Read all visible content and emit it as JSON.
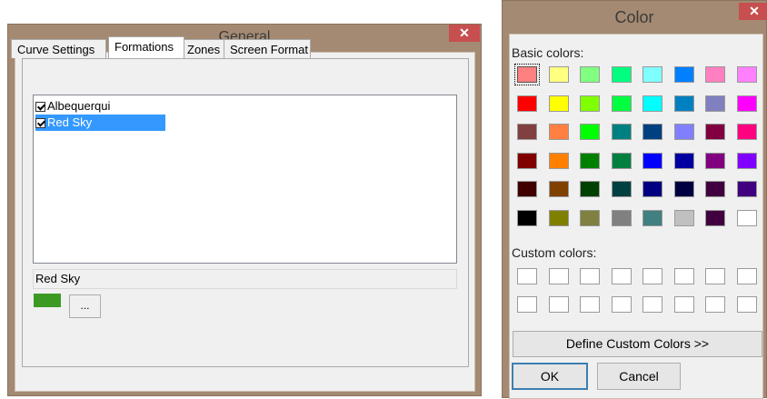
{
  "general": {
    "title": "General",
    "close_glyph": "✕",
    "tabs": [
      {
        "label": "Curve Settings"
      },
      {
        "label": "Formations"
      },
      {
        "label": "Zones"
      },
      {
        "label": "Screen Format"
      }
    ],
    "active_tab": "Formations",
    "formations": [
      {
        "label": "Albequerqui",
        "checked": true,
        "selected": false
      },
      {
        "label": "Red Sky",
        "checked": true,
        "selected": true
      }
    ],
    "selected_name": "Red Sky",
    "selected_color": "#3c9a24",
    "browse_label": "..."
  },
  "color_dialog": {
    "title": "Color",
    "close_glyph": "✕",
    "basic_label": "Basic colors:",
    "custom_label": "Custom colors:",
    "basic_colors": [
      [
        "#ff8080",
        "#ffff80",
        "#80ff80",
        "#00ff80",
        "#80ffff",
        "#0080ff",
        "#ff80c0",
        "#ff80ff"
      ],
      [
        "#ff0000",
        "#ffff00",
        "#80ff00",
        "#00ff40",
        "#00ffff",
        "#0080c0",
        "#8080c0",
        "#ff00ff"
      ],
      [
        "#804040",
        "#ff8040",
        "#00ff00",
        "#008080",
        "#004080",
        "#8080ff",
        "#800040",
        "#ff0080"
      ],
      [
        "#800000",
        "#ff8000",
        "#008000",
        "#008040",
        "#0000ff",
        "#0000a0",
        "#800080",
        "#8000ff"
      ],
      [
        "#400000",
        "#804000",
        "#004000",
        "#004040",
        "#000080",
        "#000040",
        "#400040",
        "#400080"
      ],
      [
        "#000000",
        "#808000",
        "#808040",
        "#808080",
        "#408080",
        "#c0c0c0",
        "#400040",
        "#ffffff"
      ]
    ],
    "selected_basic": "#ff8080",
    "custom_colors": [
      [
        "#ffffff",
        "#ffffff",
        "#ffffff",
        "#ffffff",
        "#ffffff",
        "#ffffff",
        "#ffffff",
        "#ffffff"
      ],
      [
        "#ffffff",
        "#ffffff",
        "#ffffff",
        "#ffffff",
        "#ffffff",
        "#ffffff",
        "#ffffff",
        "#ffffff"
      ]
    ],
    "define_label": "Define Custom Colors >>",
    "ok_label": "OK",
    "cancel_label": "Cancel"
  },
  "colors": {
    "title_bar": "#a48a72",
    "close_button": "#c74f4f",
    "selection": "#3399ff"
  }
}
